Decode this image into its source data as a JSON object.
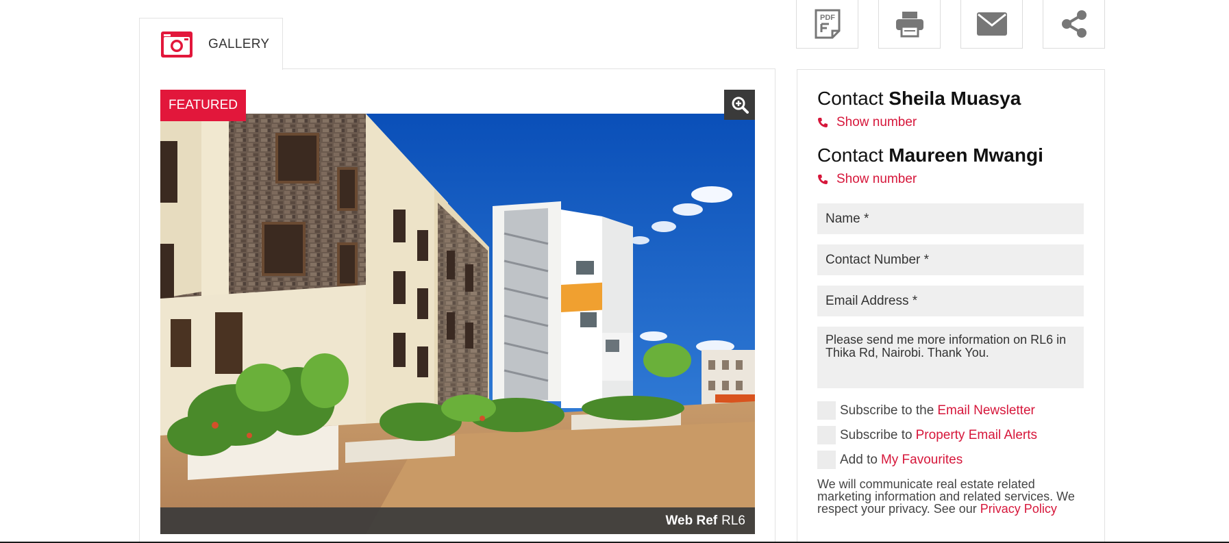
{
  "gallery": {
    "tab_label": "GALLERY",
    "featured_label": "FEATURED",
    "web_ref_label": "Web Ref",
    "web_ref_value": "RL6"
  },
  "actions": {
    "pdf_label": "PDF"
  },
  "contacts": [
    {
      "prefix": "Contact",
      "name": "Sheila Muasya",
      "show_number": "Show number"
    },
    {
      "prefix": "Contact",
      "name": "Maureen Mwangi",
      "show_number": "Show number"
    }
  ],
  "form": {
    "name_placeholder": "Name *",
    "contact_number_placeholder": "Contact Number *",
    "email_placeholder": "Email Address *",
    "message": "Please send me more information on RL6 in Thika Rd, Nairobi. Thank You.",
    "checkboxes": [
      {
        "text": "Subscribe to the",
        "link": "Email Newsletter"
      },
      {
        "text": "Subscribe to",
        "link": "Property Email Alerts"
      },
      {
        "text": "Add to",
        "link": "My Favourites"
      }
    ],
    "privacy_text": "We will communicate real estate related marketing information and related services. We respect your privacy. See our",
    "privacy_link": "Privacy Policy"
  },
  "colors": {
    "accent": "#e2173b",
    "link": "#d6163a",
    "field_bg": "#efefef"
  }
}
